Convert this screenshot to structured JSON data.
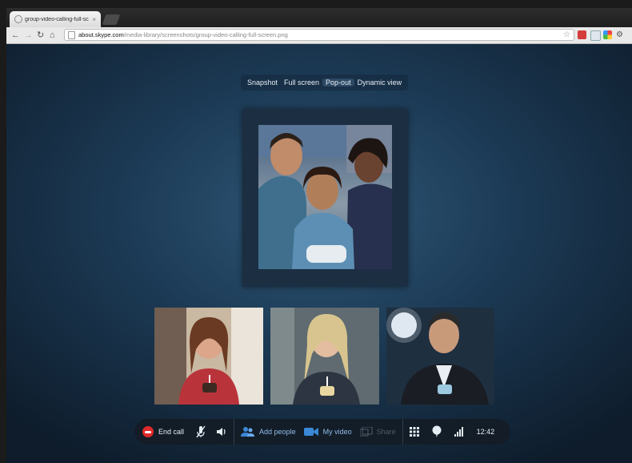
{
  "browser": {
    "tab_title": "group-video-calling-full-sc",
    "tab_close": "×",
    "url_host": "about.skype.com",
    "url_path": "/media-library/screenshots/group-video-calling-full-screen.png"
  },
  "view_modes": [
    "Snapshot",
    "Full screen",
    "Pop-out",
    "Dynamic view"
  ],
  "call_bar": {
    "end_call": "End call",
    "add_people": "Add people",
    "my_video": "My video",
    "share": "Share",
    "time": "12:42"
  },
  "colors": {
    "accent": "#3a88d6",
    "end_call": "#e02a2a"
  }
}
